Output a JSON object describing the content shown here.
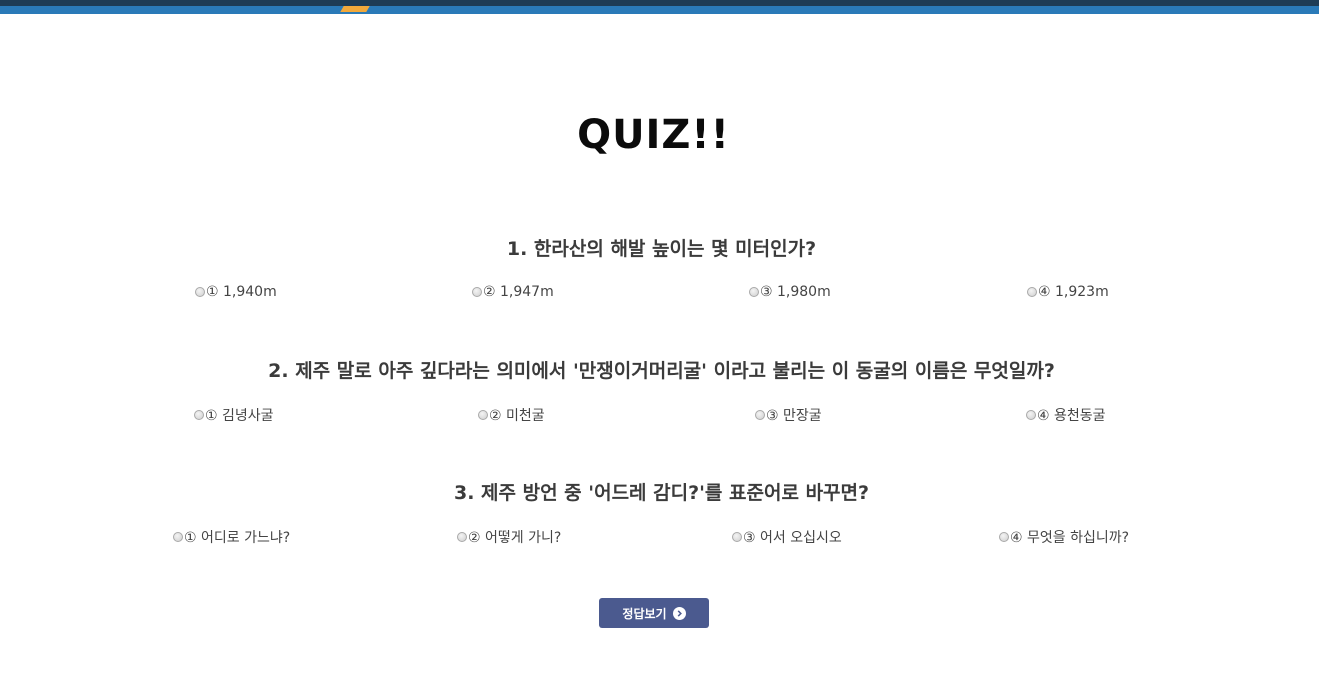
{
  "title": "QUIZ!!",
  "questions": [
    {
      "text": "1. 한라산의 해발 높이는 몇 미터인가?",
      "options": [
        "① 1,940m",
        "② 1,947m",
        "③ 1,980m",
        "④ 1,923m"
      ]
    },
    {
      "text": "2. 제주 말로 아주 깊다라는 의미에서 '만쟁이거머리굴' 이라고 불리는 이 동굴의 이름은 무엇일까?",
      "options": [
        "① 김녕사굴",
        "② 미천굴",
        "③ 만장굴",
        "④ 용천동굴"
      ]
    },
    {
      "text": "3. 제주 방언 중 '어드레 감디?'를 표준어로 바꾸면?",
      "options": [
        "① 어디로 가느냐?",
        "② 어떻게 가니?",
        "③ 어서 오십시오",
        "④ 무엇을 하십니까?"
      ]
    }
  ],
  "answer_button": {
    "label": "정답보기",
    "icon": "chevron-right-circle-icon",
    "color": "#4b5a8f"
  },
  "colors": {
    "topbar": "#2a7ab8",
    "topbar_dark": "#1e3c55",
    "accent": "#f2a93b"
  }
}
